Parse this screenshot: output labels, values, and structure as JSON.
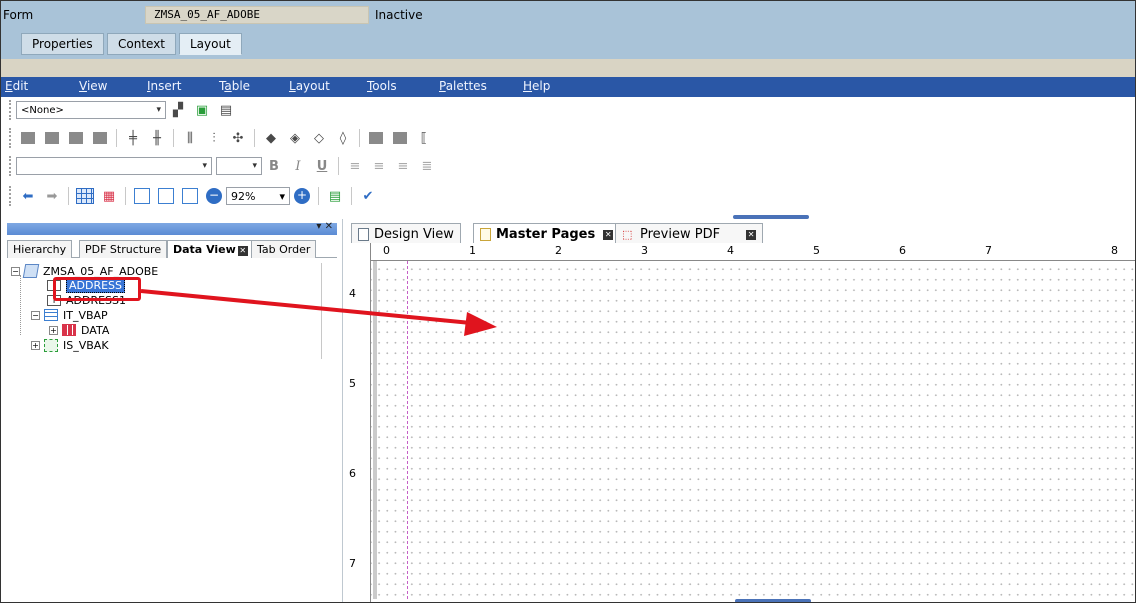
{
  "sap": {
    "form_label": "Form",
    "form_name": "ZMSA_05_AF_ADOBE",
    "form_status": "Inactive",
    "tabs": [
      {
        "label": "Properties",
        "active": false
      },
      {
        "label": "Context",
        "active": false
      },
      {
        "label": "Layout",
        "active": true
      }
    ]
  },
  "menubar": {
    "items": [
      {
        "pre": "",
        "ul": "E",
        "post": "dit"
      },
      {
        "pre": "",
        "ul": "V",
        "post": "iew"
      },
      {
        "pre": "",
        "ul": "I",
        "post": "nsert"
      },
      {
        "pre": "T",
        "ul": "a",
        "post": "ble"
      },
      {
        "pre": "",
        "ul": "L",
        "post": "ayout"
      },
      {
        "pre": "",
        "ul": "T",
        "post": "ools"
      },
      {
        "pre": "",
        "ul": "P",
        "post": "alettes"
      },
      {
        "pre": "",
        "ul": "H",
        "post": "elp"
      }
    ]
  },
  "toolbar": {
    "style_select": "<None>",
    "zoom_value": "92%",
    "bold_label": "B",
    "italic_label": "I",
    "underline_label": "U"
  },
  "left_panel": {
    "tabs": [
      {
        "label": "Hierarchy",
        "active": false
      },
      {
        "label": "PDF Structure",
        "active": false
      },
      {
        "label": "Data View",
        "active": true
      },
      {
        "label": "Tab Order",
        "active": false
      }
    ],
    "tree": {
      "root": "ZMSA_05_AF_ADOBE",
      "address": "ADDRESS",
      "address1": "ADDRESS1",
      "it_vbap": "IT_VBAP",
      "data": "DATA",
      "is_vbak": "IS_VBAK"
    }
  },
  "right_pane": {
    "tabs": [
      {
        "label": "Design View",
        "active": false
      },
      {
        "label": "Master Pages",
        "active": true
      },
      {
        "label": "Preview PDF",
        "active": false
      }
    ],
    "ruler_h": [
      "0",
      "1",
      "2",
      "3",
      "4",
      "5",
      "6",
      "7",
      "8"
    ],
    "ruler_v": [
      "4",
      "5",
      "6",
      "7"
    ]
  },
  "colors": {
    "sap_header": "#a9c3d8",
    "menubar": "#2a57a6",
    "highlight": "#e0141e",
    "selection": "#3875d7"
  }
}
